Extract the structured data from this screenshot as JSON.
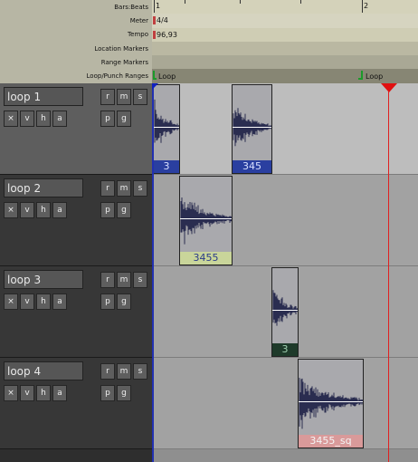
{
  "ruler": {
    "labels": [
      "Bars:Beats",
      "Meter",
      "Tempo",
      "Location Markers",
      "Range Markers",
      "Loop/Punch Ranges"
    ],
    "bar1": "1",
    "bar2": "2",
    "meter": "4/4",
    "tempo": "96,93",
    "loop_start": "Loop",
    "loop_end": "Loop"
  },
  "tracks": [
    {
      "name": "loop 1",
      "btn_x": "×",
      "btn_v": "v",
      "btn_h": "h",
      "btn_a": "a",
      "btn_r": "r",
      "btn_m": "m",
      "btn_s": "s",
      "btn_p": "p",
      "btn_g": "g"
    },
    {
      "name": "loop 2",
      "btn_x": "×",
      "btn_v": "v",
      "btn_h": "h",
      "btn_a": "a",
      "btn_r": "r",
      "btn_m": "m",
      "btn_s": "s",
      "btn_p": "p",
      "btn_g": "g"
    },
    {
      "name": "loop 3",
      "btn_x": "×",
      "btn_v": "v",
      "btn_h": "h",
      "btn_a": "a",
      "btn_r": "r",
      "btn_m": "m",
      "btn_s": "s",
      "btn_p": "p",
      "btn_g": "g"
    },
    {
      "name": "loop 4",
      "btn_x": "×",
      "btn_v": "v",
      "btn_h": "h",
      "btn_a": "a",
      "btn_r": "r",
      "btn_m": "m",
      "btn_s": "s",
      "btn_p": "p",
      "btn_g": "g"
    }
  ],
  "regions": [
    {
      "name": "3",
      "bg": "#2a3fa0",
      "fg": "#d8e0ff"
    },
    {
      "name": "345",
      "bg": "#2a3fa0",
      "fg": "#d8e0ff"
    },
    {
      "name": "3455",
      "bg": "#c9d59a",
      "fg": "#2a3a8a"
    },
    {
      "name": "3",
      "bg": "#1e3a2a",
      "fg": "#9fd0b0"
    },
    {
      "name": "3455_sq",
      "bg": "#d99a9a",
      "fg": "#f4f4f4"
    }
  ],
  "colors": {
    "playhead": "#e02020",
    "waveform": "#2a2d50"
  }
}
